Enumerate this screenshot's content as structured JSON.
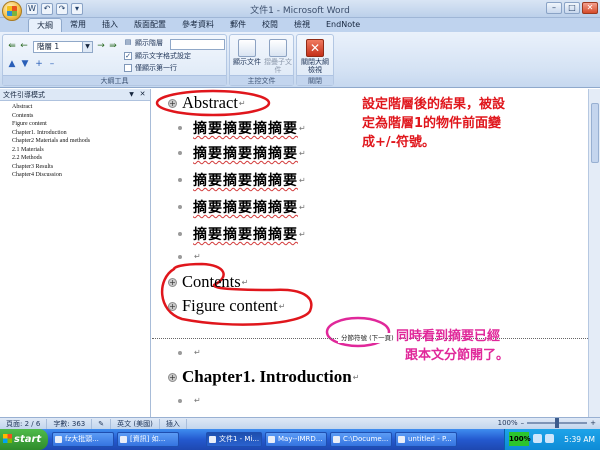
{
  "window": {
    "title": "文件1 - Microsoft Word",
    "controls": [
      "–",
      "□",
      "✕"
    ]
  },
  "qat": [
    "W",
    "↶",
    "↷",
    "▾"
  ],
  "tabs": [
    "大綱",
    "常用",
    "插入",
    "版面配置",
    "參考資料",
    "郵件",
    "校閱",
    "檢視",
    "EndNote"
  ],
  "ribbon": {
    "level_select": "階層 1",
    "show_level_label": "顯示階層",
    "show_text_format_label": "顯示文字格式設定",
    "show_first_line_label": "僅顯示第一行",
    "show_text_format_checked": "✓",
    "group_outline_tools": "大綱工具",
    "show_document_label": "顯示文件",
    "collapse_subdocs_label": "摺疊子文件",
    "group_master_document": "主控文件",
    "close_outline_label": "關閉大綱檢視",
    "group_close": "關閉"
  },
  "nav": {
    "title": "文件引導模式",
    "items": [
      "Abstract",
      "Contents",
      "Figure content",
      "Chapter1. Introduction",
      "Chapter2 Materials and methods",
      "2.1 Materials",
      "2.2 Methods",
      "Chapter3 Results",
      "Chapter4 Discussion"
    ]
  },
  "document": {
    "abstract_heading": "Abstract",
    "body_lines": [
      "摘要摘要摘摘要",
      "摘要摘要摘摘要",
      "摘要摘要摘摘要",
      "摘要摘要摘摘要",
      "摘要摘要摘摘要"
    ],
    "contents_heading": "Contents",
    "figure_heading": "Figure content",
    "section_break_label": "分節符號 (下一頁)",
    "chapter1_heading": "Chapter1. Introduction",
    "para_mark": "↵",
    "plus_symbol": "+",
    "annotation_1": [
      "設定階層後的結果，被設",
      "定為階層1的物件前面變",
      "成+/-符號。"
    ],
    "annotation_2": [
      "同時看到摘要已經",
      "跟本文分節開了。"
    ]
  },
  "statusbar": {
    "page": "頁面: 2 / 6",
    "words": "字數: 363",
    "language": "英文 (美國)",
    "insert_mode": "插入",
    "zoom": "100%"
  },
  "taskbar": {
    "start_label": "start",
    "tasks": [
      "fz大批頭...",
      "[資訊] 如...",
      "文件1 - Mi...",
      "May--IMRD...",
      "C:\\Docume...",
      "untitled - P..."
    ],
    "tray_percent": "100%",
    "clock": "5:39 AM"
  }
}
